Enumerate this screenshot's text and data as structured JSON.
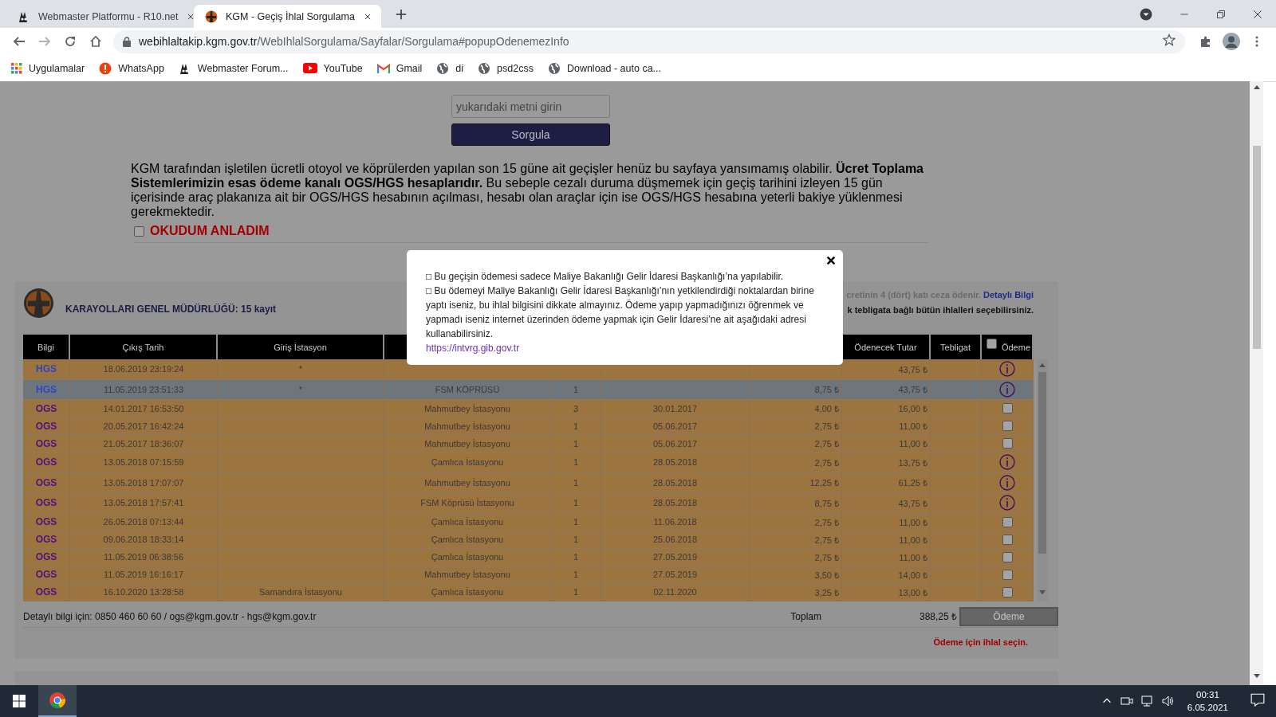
{
  "browser": {
    "tabs": [
      {
        "title": "Webmaster Platformu - R10.net",
        "selected": false,
        "kind": "webmaster"
      },
      {
        "title": "KGM - Geçiş İhlal Sorgulama",
        "selected": true,
        "kind": "kgm"
      }
    ],
    "address": {
      "host": "webihlaltakip.kgm.gov.tr",
      "path": "/WebIhlalSorgulama/Sayfalar/Sorgulama#popupOdenemezInfo"
    },
    "bookmarks": [
      {
        "label": "Uygulamalar",
        "kind": "apps"
      },
      {
        "label": "WhatsApp",
        "kind": "alert"
      },
      {
        "label": "Webmaster Forum...",
        "kind": "webmaster"
      },
      {
        "label": "YouTube",
        "kind": "youtube"
      },
      {
        "label": "Gmail",
        "kind": "gmail"
      },
      {
        "label": "di",
        "kind": "globe"
      },
      {
        "label": "psd2css",
        "kind": "globe"
      },
      {
        "label": "Download - auto ca...",
        "kind": "globe"
      }
    ]
  },
  "query": {
    "captcha_placeholder": "yukarıdaki metni girin",
    "submit": "Sorgula",
    "notice": "KGM tarafından işletilen ücretli otoyol ve köprülerden yapılan son 15 güne ait geçişler henüz bu sayfaya yansımamış olabilir. **Ücret Toplama Sistemlerimizin esas ödeme kanalı OGS/HGS hesaplarıdır.** Bu sebeple cezalı duruma düşmemek için geçiş tarihini izleyen 15 gün içerisinde araç plakanıza ait bir OGS/HGS hesabının açılması, hesabı olan araçlar için ise OGS/HGS hesabına yeterli bakiye yüklenmesi gerekmektedir.",
    "consent": {
      "label": "OKUDUM ANLADIM",
      "checked": false
    }
  },
  "results": {
    "title": "KARAYOLLARI GENEL MÜDÜRLÜĞÜ: 15 kayıt",
    "notice_line_1": "cretinin 4 (dört) katı ceza ödenir.",
    "notice_link": "Detaylı Bilgi",
    "notice_line_2": "k tebligata bağlı bütün ihlalleri seçebilirsiniz.",
    "table": {
      "columns": [
        "Bilgi",
        "Çıkış Tarih",
        "Giriş İstasyon",
        "Ödenecek Tutar",
        "Tebligat",
        "Ödeme"
      ],
      "select_all": {
        "checked": false
      },
      "rows": [
        {
          "type": "HGS",
          "color": "#2f45c8",
          "exit_time": "18.06.2019 23:19:24",
          "entry_station": "*",
          "amount_due": "43,75 ₺",
          "payment": {
            "kind": "info"
          },
          "selected": false
        },
        {
          "type": "HGS",
          "color": "#2f45c8",
          "exit_time": "11.05.2019 23:51:33",
          "entry_station": "*",
          "exit_station": "FSM KÖPRÜSÜ",
          "column_5": "1",
          "column_7": "8,75 ₺",
          "amount_due": "43,75 ₺",
          "payment": {
            "kind": "info"
          },
          "selected": true
        },
        {
          "type": "OGS",
          "color": "#4e1380",
          "exit_time": "14.01.2017 16:53:50",
          "exit_station": "Mahmutbey İstasyonu",
          "column_5": "3",
          "column_6": "30.01.2017",
          "column_7": "4,00 ₺",
          "amount_due": "16,00 ₺",
          "payment": {
            "kind": "checkbox",
            "checked": false
          },
          "selected": false
        },
        {
          "type": "OGS",
          "color": "#4e1380",
          "exit_time": "20.05.2017 16:42:24",
          "exit_station": "Mahmutbey İstasyonu",
          "column_5": "1",
          "column_6": "05.06.2017",
          "column_7": "2,75 ₺",
          "amount_due": "11,00 ₺",
          "payment": {
            "kind": "checkbox",
            "checked": false
          },
          "selected": false
        },
        {
          "type": "OGS",
          "color": "#4e1380",
          "exit_time": "21.05.2017 18:36:07",
          "exit_station": "Mahmutbey İstasyonu",
          "column_5": "1",
          "column_6": "05.06.2017",
          "column_7": "2,75 ₺",
          "amount_due": "11,00 ₺",
          "payment": {
            "kind": "checkbox",
            "checked": false
          },
          "selected": false
        },
        {
          "type": "OGS",
          "color": "#4e1380",
          "exit_time": "13.05.2018 07:15:59",
          "exit_station": "Çamlıca İstasyonu",
          "column_5": "1",
          "column_6": "28.05.2018",
          "column_7": "2,75 ₺",
          "amount_due": "13,75 ₺",
          "payment": {
            "kind": "info"
          },
          "selected": false
        },
        {
          "type": "OGS",
          "color": "#4e1380",
          "exit_time": "13.05.2018 17:07:07",
          "exit_station": "Mahmutbey İstasyonu",
          "column_5": "1",
          "column_6": "28.05.2018",
          "column_7": "12,25 ₺",
          "amount_due": "61,25 ₺",
          "payment": {
            "kind": "info"
          },
          "selected": false
        },
        {
          "type": "OGS",
          "color": "#4e1380",
          "exit_time": "13.05.2018 17:57:41",
          "exit_station": "FSM Köprüsü İstasyonu",
          "column_5": "1",
          "column_6": "28.05.2018",
          "column_7": "8,75 ₺",
          "amount_due": "43,75 ₺",
          "payment": {
            "kind": "info"
          },
          "selected": false
        },
        {
          "type": "OGS",
          "color": "#4e1380",
          "exit_time": "26.05.2018 07:13:44",
          "exit_station": "Çamlıca İstasyonu",
          "column_5": "1",
          "column_6": "11.06.2018",
          "column_7": "2,75 ₺",
          "amount_due": "11,00 ₺",
          "payment": {
            "kind": "checkbox",
            "checked": false
          },
          "selected": false
        },
        {
          "type": "OGS",
          "color": "#4e1380",
          "exit_time": "09.06.2018 18:33:14",
          "exit_station": "Çamlıca İstasyonu",
          "column_5": "1",
          "column_6": "25.06.2018",
          "column_7": "2,75 ₺",
          "amount_due": "11,00 ₺",
          "payment": {
            "kind": "checkbox",
            "checked": false
          },
          "selected": false
        },
        {
          "type": "OGS",
          "color": "#4e1380",
          "exit_time": "11.05.2019 06:38:56",
          "exit_station": "Çamlıca İstasyonu",
          "column_5": "1",
          "column_6": "27.05.2019",
          "column_7": "2,75 ₺",
          "amount_due": "11,00 ₺",
          "payment": {
            "kind": "checkbox",
            "checked": false
          },
          "selected": false
        },
        {
          "type": "OGS",
          "color": "#4e1380",
          "exit_time": "11.05.2019 16:16:17",
          "exit_station": "Mahmutbey İstasyonu",
          "column_5": "1",
          "column_6": "27.05.2019",
          "column_7": "3,50 ₺",
          "amount_due": "14,00 ₺",
          "payment": {
            "kind": "checkbox",
            "checked": false
          },
          "selected": false
        },
        {
          "type": "OGS",
          "color": "#4e1380",
          "exit_time": "16.10.2020 13:28:58",
          "entry_station": "Samandıra İstasyonu",
          "exit_station": "Çamlıca İstasyonu",
          "column_5": "1",
          "column_6": "02.11.2020",
          "column_7": "3,25 ₺",
          "amount_due": "13,00 ₺",
          "payment": {
            "kind": "checkbox",
            "checked": false
          },
          "selected": false
        }
      ]
    },
    "footer": {
      "contact": "Detaylı bilgi için: 0850 460 60 60 / ogs@kgm.gov.tr - hgs@kgm.gov.tr",
      "total_label": "Toplam",
      "total": "388,25 ₺",
      "pay_button": "Ödeme",
      "pay_disabled": true,
      "hint": "Ödeme için ihlal seçin."
    }
  },
  "popup": {
    "paragraphs": [
      "□ Bu geçişin ödemesi sadece Maliye Bakanlığı Gelir İdaresi Başkanlığı’na yapılabilir.",
      "□ Bu ödemeyi Maliye Bakanlığı Gelir İdaresi Başkanlığı’nın yetkilendirdiği noktalardan birine yaptı iseniz, bu ihlal bilgisini dikkate almayınız. Ödeme yapıp yapmadığınızı öğrenmek ve yapmadı iseniz internet üzerinden ödeme yapmak için Gelir İdaresi’ne ait aşağıdaki adresi kullanabilirsiniz."
    ],
    "link": "https://intvrg.gib.gov.tr"
  },
  "taskbar": {
    "time": "00:31",
    "date": "6.05.2021"
  }
}
